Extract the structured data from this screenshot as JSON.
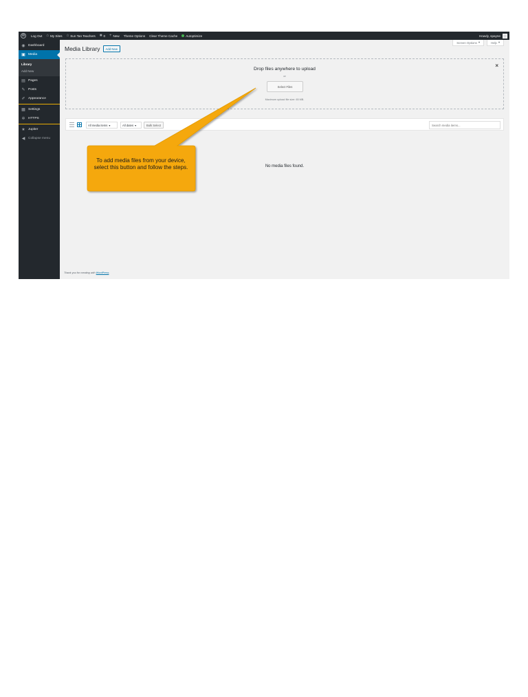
{
  "admin_bar": {
    "log_out": "Log Out",
    "my_sites": "My Sites",
    "site_name": "Sun Tan Teachers",
    "comments_count": "0",
    "new": "New",
    "theme_options": "Theme Options",
    "clear_theme_cache": "Clear Theme Cache",
    "autoptimize": "Autoptimize",
    "howdy": "Howdy, spayne"
  },
  "sidebar": {
    "items": [
      {
        "label": "Dashboard",
        "icon": "dashboard-icon"
      },
      {
        "label": "Media",
        "icon": "media-icon",
        "active": true
      },
      {
        "label": "Pages",
        "icon": "pages-icon"
      },
      {
        "label": "Posts",
        "icon": "posts-icon"
      },
      {
        "label": "Appearance",
        "icon": "appearance-icon"
      },
      {
        "label": "Settings",
        "icon": "settings-icon"
      },
      {
        "label": "HTTPS",
        "icon": "https-icon"
      },
      {
        "label": "Jupiter",
        "icon": "jupiter-icon"
      },
      {
        "label": "Collapse menu",
        "icon": "collapse-icon"
      }
    ],
    "media_submenu": [
      "Library",
      "Add New"
    ]
  },
  "screen_meta": {
    "screen_options": "Screen Options",
    "help": "Help"
  },
  "page": {
    "title": "Media Library",
    "add_new": "Add New"
  },
  "uploader": {
    "drop_title": "Drop files anywhere to upload",
    "or": "or",
    "select_files": "Select Files",
    "max_size": "Maximum upload file size: 65 MB.",
    "close": "×"
  },
  "filters": {
    "media_type": "All media items",
    "dates": "All dates",
    "bulk_select": "Bulk Select",
    "search_placeholder": "Search media items..."
  },
  "empty_state": "No media files found.",
  "footer": {
    "thanks_prefix": "Thank you for creating with",
    "wordpress_link": "WordPress",
    "thanks_suffix": "."
  },
  "callout": {
    "text": "To add media files from your device, select this button and follow the steps.",
    "color": "#f5a80a"
  },
  "colors": {
    "admin_dark": "#23282d",
    "accent_blue": "#0073aa",
    "content_bg": "#f1f1f1"
  }
}
